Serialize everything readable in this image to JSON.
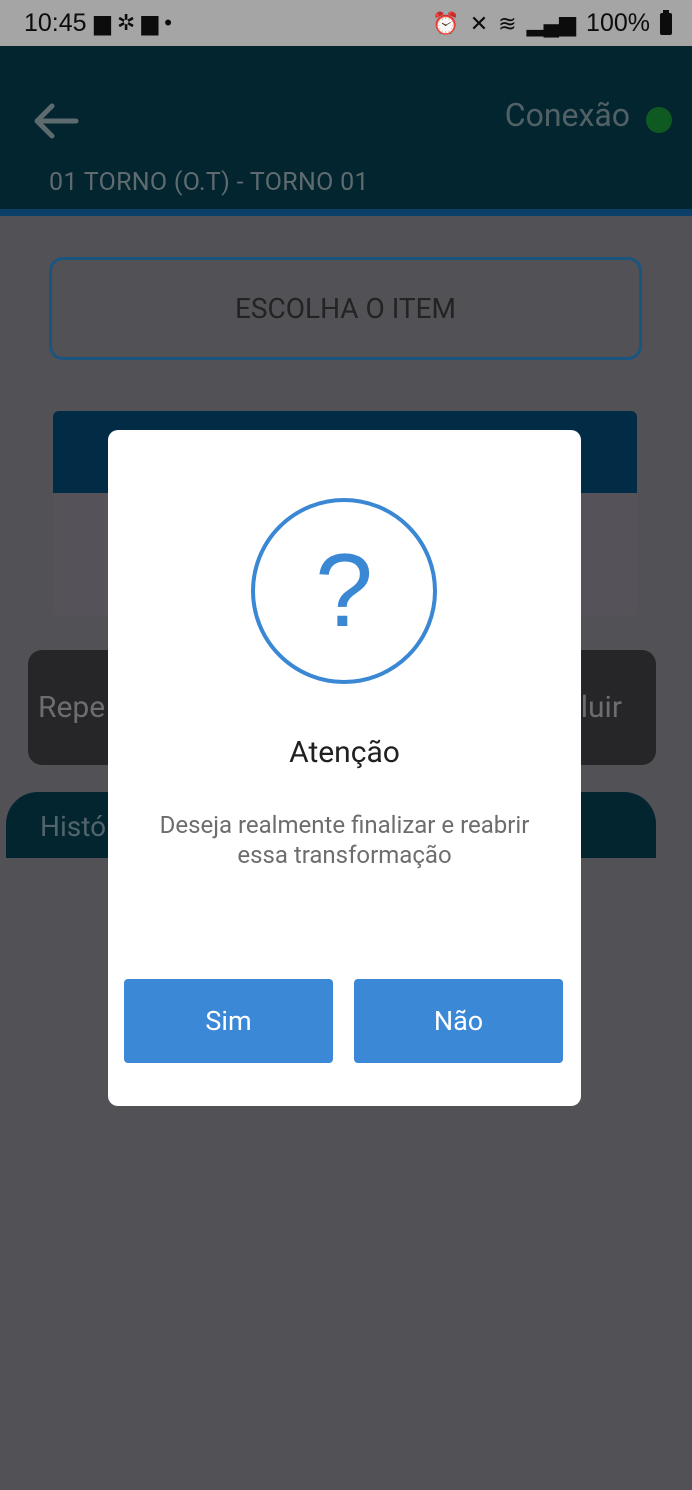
{
  "status_bar": {
    "time": "10:45",
    "battery": "100%",
    "icons": [
      "notification-icon",
      "fan-icon",
      "notification-icon",
      "dot-icon",
      "alarm-icon",
      "mute-icon",
      "wifi-icon",
      "volte-icon",
      "signal-icon",
      "battery-icon"
    ]
  },
  "header": {
    "connection_label": "Conexão",
    "connection_color": "#0f5a20",
    "machine_title": "01 TORNO (O.T) - TORNO 01"
  },
  "main": {
    "choose_item_label": "ESCOLHA O ITEM",
    "action_left_label": "Repe",
    "action_right_label": "luir",
    "history_label": "Histó"
  },
  "dialog": {
    "icon": "question-icon",
    "icon_glyph": "?",
    "title": "Atenção",
    "message": "Deseja realmente finalizar e reabrir essa transformação",
    "yes_label": "Sim",
    "no_label": "Não",
    "accent_color": "#3a88d6"
  }
}
